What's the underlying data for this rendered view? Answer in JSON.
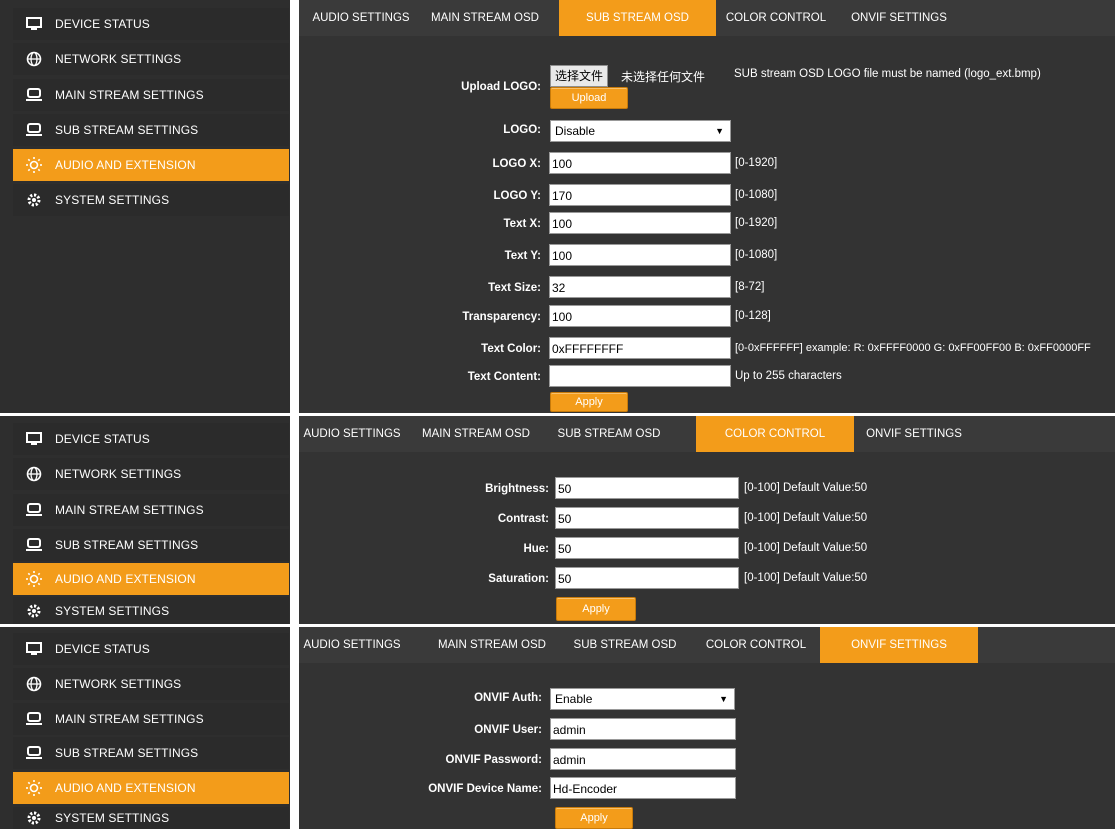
{
  "sidebar": {
    "items": [
      {
        "label": "DEVICE STATUS",
        "icon": "monitor-icon"
      },
      {
        "label": "NETWORK SETTINGS",
        "icon": "globe-icon"
      },
      {
        "label": "MAIN STREAM SETTINGS",
        "icon": "stream-icon"
      },
      {
        "label": "SUB STREAM SETTINGS",
        "icon": "stream-icon"
      },
      {
        "label": "AUDIO AND EXTENSION",
        "icon": "sun-icon",
        "active": true
      },
      {
        "label": "SYSTEM SETTINGS",
        "icon": "gear-icon"
      }
    ]
  },
  "tabs": [
    "AUDIO SETTINGS",
    "MAIN STREAM OSD",
    "SUB STREAM OSD",
    "COLOR CONTROL",
    "ONVIF SETTINGS"
  ],
  "panel1": {
    "active_tab": "SUB STREAM OSD",
    "upload_label": "Upload LOGO:",
    "file_button": "选择文件",
    "file_status": "未选择任何文件",
    "file_note": "SUB stream OSD LOGO file must be named (logo_ext.bmp)",
    "upload_button": "Upload",
    "logo_label": "LOGO:",
    "logo_value": "Disable",
    "fields": [
      {
        "label": "LOGO X:",
        "value": "100",
        "hint": "[0-1920]"
      },
      {
        "label": "LOGO Y:",
        "value": "170",
        "hint": "[0-1080]"
      },
      {
        "label": "Text X:",
        "value": "100",
        "hint": "[0-1920]"
      },
      {
        "label": "Text Y:",
        "value": "100",
        "hint": "[0-1080]"
      },
      {
        "label": "Text Size:",
        "value": "32",
        "hint": "[8-72]"
      },
      {
        "label": "Transparency:",
        "value": "100",
        "hint": "[0-128]"
      },
      {
        "label": "Text Color:",
        "value": "0xFFFFFFFF",
        "hint": "[0-0xFFFFFF] example: R: 0xFFFF0000 G: 0xFF00FF00 B: 0xFF0000FF"
      },
      {
        "label": "Text Content:",
        "value": "",
        "hint": "Up to 255 characters"
      }
    ],
    "apply": "Apply"
  },
  "panel2": {
    "active_tab": "COLOR CONTROL",
    "fields": [
      {
        "label": "Brightness:",
        "value": "50",
        "hint": "[0-100] Default Value:50"
      },
      {
        "label": "Contrast:",
        "value": "50",
        "hint": "[0-100] Default Value:50"
      },
      {
        "label": "Hue:",
        "value": "50",
        "hint": "[0-100] Default Value:50"
      },
      {
        "label": "Saturation:",
        "value": "50",
        "hint": "[0-100] Default Value:50"
      }
    ],
    "apply": "Apply"
  },
  "panel3": {
    "active_tab": "ONVIF SETTINGS",
    "auth_label": "ONVIF Auth:",
    "auth_value": "Enable",
    "fields": [
      {
        "label": "ONVIF User:",
        "value": "admin"
      },
      {
        "label": "ONVIF Password:",
        "value": "admin"
      },
      {
        "label": "ONVIF Device Name:",
        "value": "Hd-Encoder"
      }
    ],
    "apply": "Apply"
  },
  "colors": {
    "accent": "#f39c1a",
    "sidebar_bg": "#2b2b2b",
    "content_bg": "#333333"
  }
}
